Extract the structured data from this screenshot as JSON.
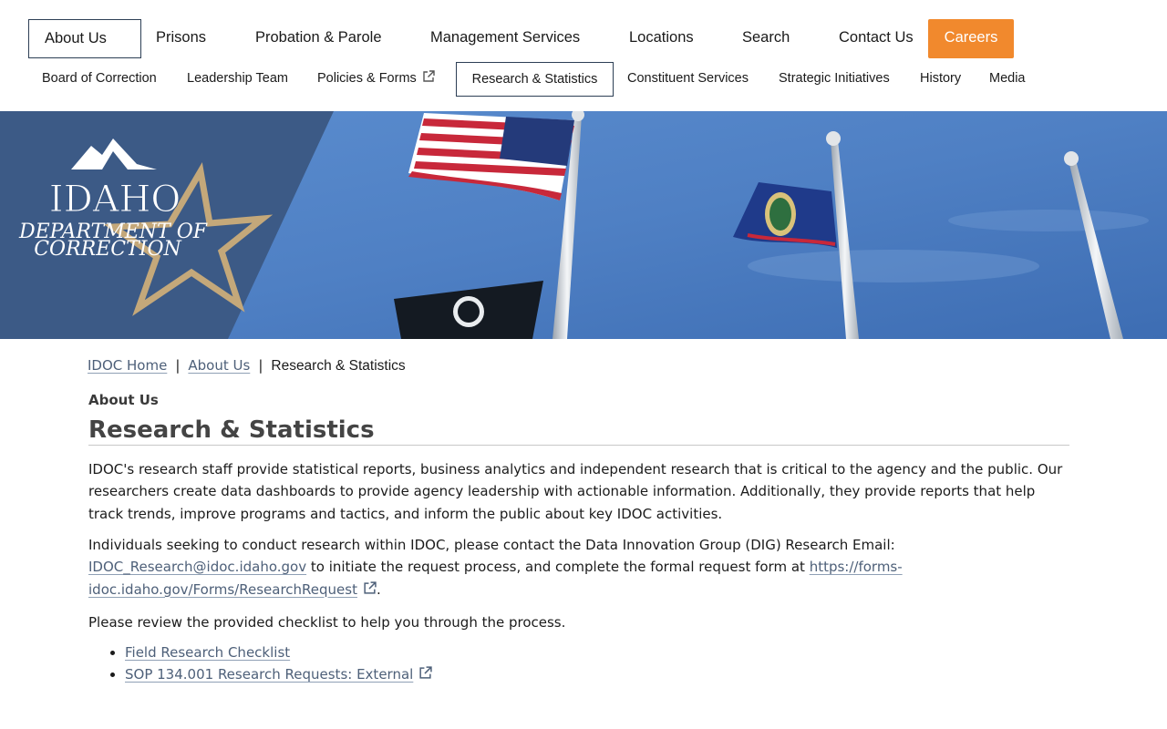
{
  "main_nav": {
    "items": [
      "About Us",
      "Prisons",
      "Probation & Parole",
      "Management Services",
      "Locations",
      "Search",
      "Contact Us"
    ],
    "careers": "Careers",
    "accent_color": "#f1892d"
  },
  "sub_nav": {
    "items": [
      "Board of Correction",
      "Leadership Team",
      "Policies & Forms",
      "Research & Statistics",
      "Constituent Services",
      "Strategic Initiatives",
      "History",
      "Media"
    ]
  },
  "banner": {
    "logo_title": "IDAHO",
    "logo_subtitle_1": "DEPARTMENT OF",
    "logo_subtitle_2": "CORRECTION",
    "colors": {
      "panel": "#3c5a86",
      "star": "#c4a87a",
      "sky": "#4f80c4"
    }
  },
  "breadcrumb": {
    "home": "IDOC Home",
    "parent": "About Us",
    "separator": "|",
    "current": "Research & Statistics"
  },
  "content": {
    "section_label": "About Us",
    "title": "Research & Statistics",
    "para1": "IDOC's research staff provide statistical reports, business analytics and independent research that is critical to the agency and the public. Our researchers create data dashboards to provide agency leadership with actionable information. Additionally, they provide reports that help track trends, improve programs and tactics, and inform the public about key IDOC activities.",
    "para2_before": "Individuals seeking to conduct research within IDOC, please contact the Data Innovation Group (DIG) Research Email: ",
    "email": "IDOC_Research@idoc.idaho.gov",
    "para2_middle": " to initiate the request process, and complete the formal request form at ",
    "form_url": "https://forms-idoc.idaho.gov/Forms/ResearchRequest",
    "para2_end": ".",
    "para3": "Please review the provided checklist to help you through the process.",
    "links": [
      "Field Research Checklist",
      "SOP 134.001 Research Requests: External"
    ]
  }
}
